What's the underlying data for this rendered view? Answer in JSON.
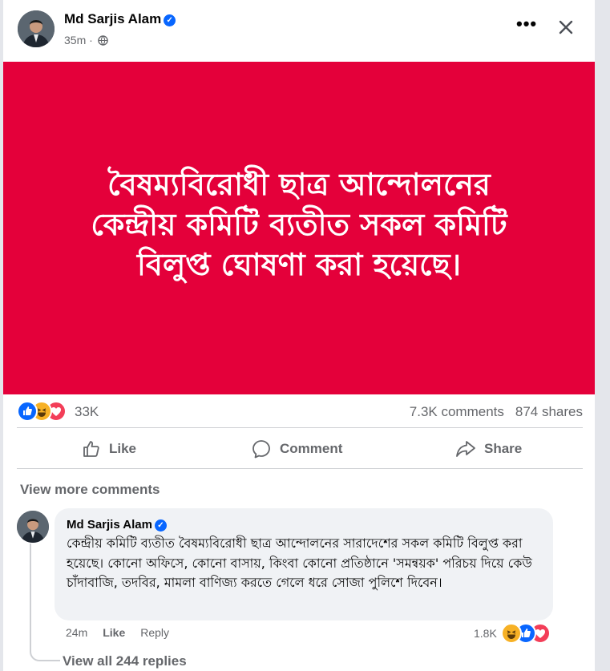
{
  "post": {
    "author": "Md Sarjis Alam",
    "time": "35m ·",
    "banner_lines": [
      "বৈষম্যবিরোধী ছাত্র আন্দোলনের",
      "কেন্দ্রীয় কমিটি ব্যতীত সকল কমিটি",
      "বিলুপ্ত ঘোষণা করা হয়েছে।"
    ],
    "banner_color": "#e4003a"
  },
  "stats": {
    "reaction_count": "33K",
    "comments": "7.3K comments",
    "shares": "874 shares",
    "reaction_icons": [
      "like-icon",
      "haha-icon",
      "love-icon"
    ]
  },
  "actions": {
    "like": "Like",
    "comment": "Comment",
    "share": "Share"
  },
  "comments": {
    "view_more": "View more comments",
    "top": {
      "author": "Md Sarjis Alam",
      "text": "কেন্দ্রীয় কমিটি ব্যতীত বৈষম্যবিরোধী ছাত্র আন্দোলনের সারাদেশের সকল কমিটি বিলুপ্ত করা হয়েছে। কোনো অফিসে, কোনো বাসায়, কিংবা কোনো প্রতিষ্ঠানে 'সমন্বয়ক' পরিচয় দিয়ে কেউ চাঁদাবাজি, তদবির, মামলা বাণিজ্য করতে গেলে ধরে সোজা পুলিশে দিবেন।",
      "time": "24m",
      "like": "Like",
      "reply": "Reply",
      "reaction_count": "1.8K",
      "reaction_icons": [
        "haha-icon",
        "like-icon",
        "love-icon"
      ]
    },
    "view_replies": "View all 244 replies"
  },
  "colors": {
    "accent": "#0866ff",
    "love": "#f33e58",
    "haha": "#f7b125"
  }
}
